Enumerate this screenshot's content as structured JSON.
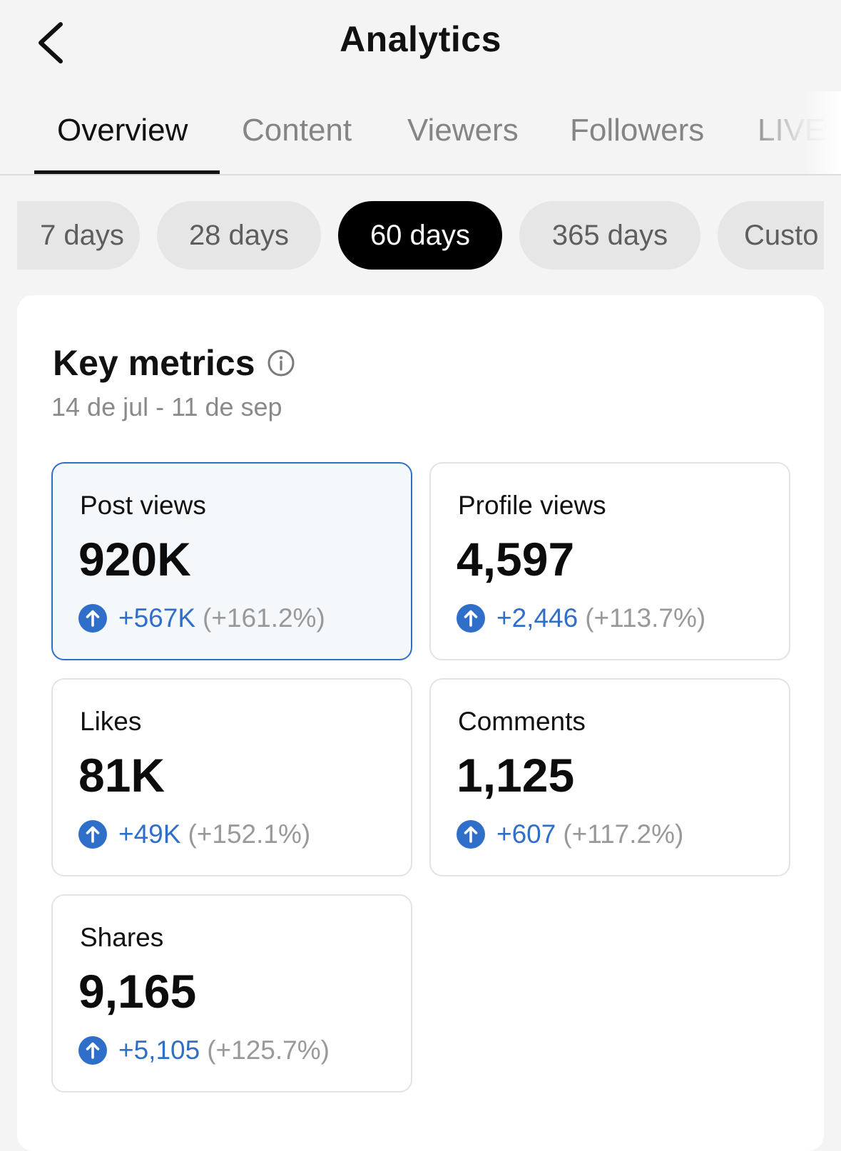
{
  "header": {
    "title": "Analytics",
    "back_icon": "chevron-left-icon"
  },
  "tabs": [
    {
      "label": "Overview",
      "active": true
    },
    {
      "label": "Content",
      "active": false
    },
    {
      "label": "Viewers",
      "active": false
    },
    {
      "label": "Followers",
      "active": false
    },
    {
      "label": "LIVE",
      "active": false
    }
  ],
  "periods": [
    {
      "label": "7 days",
      "active": false
    },
    {
      "label": "28 days",
      "active": false
    },
    {
      "label": "60 days",
      "active": true
    },
    {
      "label": "365 days",
      "active": false
    },
    {
      "label": "Custo",
      "active": false
    }
  ],
  "key_metrics": {
    "title": "Key metrics",
    "info_icon": "info-icon",
    "date_range": "14 de jul - 11 de sep",
    "metrics": [
      {
        "label": "Post views",
        "value": "920K",
        "change": "+567K",
        "change_pct": "(+161.2%)",
        "selected": true
      },
      {
        "label": "Profile views",
        "value": "4,597",
        "change": "+2,446",
        "change_pct": "(+113.7%)",
        "selected": false
      },
      {
        "label": "Likes",
        "value": "81K",
        "change": "+49K",
        "change_pct": "(+152.1%)",
        "selected": false
      },
      {
        "label": "Comments",
        "value": "1,125",
        "change": "+607",
        "change_pct": "(+117.2%)",
        "selected": false
      },
      {
        "label": "Shares",
        "value": "9,165",
        "change": "+5,105",
        "change_pct": "(+125.7%)",
        "selected": false
      }
    ]
  },
  "colors": {
    "accent_blue": "#2f6fca",
    "active_chip": "#000000",
    "inactive_chip": "#e6e6e6",
    "background": "#f4f4f4"
  }
}
